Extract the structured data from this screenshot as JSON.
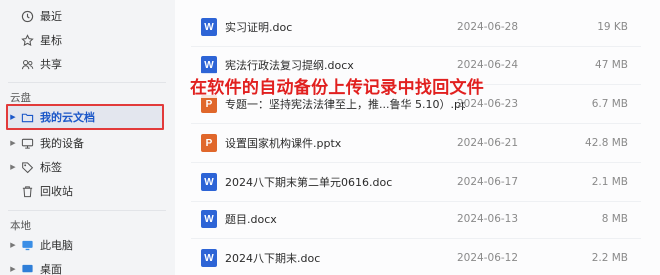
{
  "sidebar": {
    "top_items": [
      {
        "label": "最近",
        "icon": "clock-icon"
      },
      {
        "label": "星标",
        "icon": "star-icon"
      },
      {
        "label": "共享",
        "icon": "share-icon"
      }
    ],
    "cloud_section_title": "云盘",
    "cloud_items": [
      {
        "label": "我的云文档",
        "icon": "folder-icon",
        "selected": true
      },
      {
        "label": "我的设备",
        "icon": "device-icon"
      },
      {
        "label": "标签",
        "icon": "tag-icon"
      },
      {
        "label": "回收站",
        "icon": "trash-icon"
      }
    ],
    "local_section_title": "本地",
    "local_items": [
      {
        "label": "此电脑",
        "icon": "computer-icon"
      },
      {
        "label": "桌面",
        "icon": "desktop-icon"
      }
    ]
  },
  "files": [
    {
      "name": "实习证明.doc",
      "type": "W",
      "date": "2024-06-28",
      "size": "19 KB"
    },
    {
      "name": "宪法行政法复习提纲.docx",
      "type": "W",
      "date": "2024-06-24",
      "size": "47 MB"
    },
    {
      "name": "专题一：坚持宪法法律至上，推...鲁华 5.10）.pptx",
      "type": "P",
      "date": "2024-06-23",
      "size": "6.7 MB"
    },
    {
      "name": "设置国家机构课件.pptx",
      "type": "P",
      "date": "2024-06-21",
      "size": "42.8 MB"
    },
    {
      "name": "2024八下期末第二单元0616.doc",
      "type": "W",
      "date": "2024-06-17",
      "size": "2.1 MB"
    },
    {
      "name": "题目.docx",
      "type": "W",
      "date": "2024-06-13",
      "size": "8 MB"
    },
    {
      "name": "2024八下期末.doc",
      "type": "W",
      "date": "2024-06-12",
      "size": "2.2 MB"
    }
  ],
  "annotation": "在软件的自动备份上传记录中找回文件",
  "colors": {
    "highlight_border": "#e23a3a",
    "word": "#2d64d6",
    "ppt": "#e0672b",
    "annotation": "#e1201f"
  }
}
